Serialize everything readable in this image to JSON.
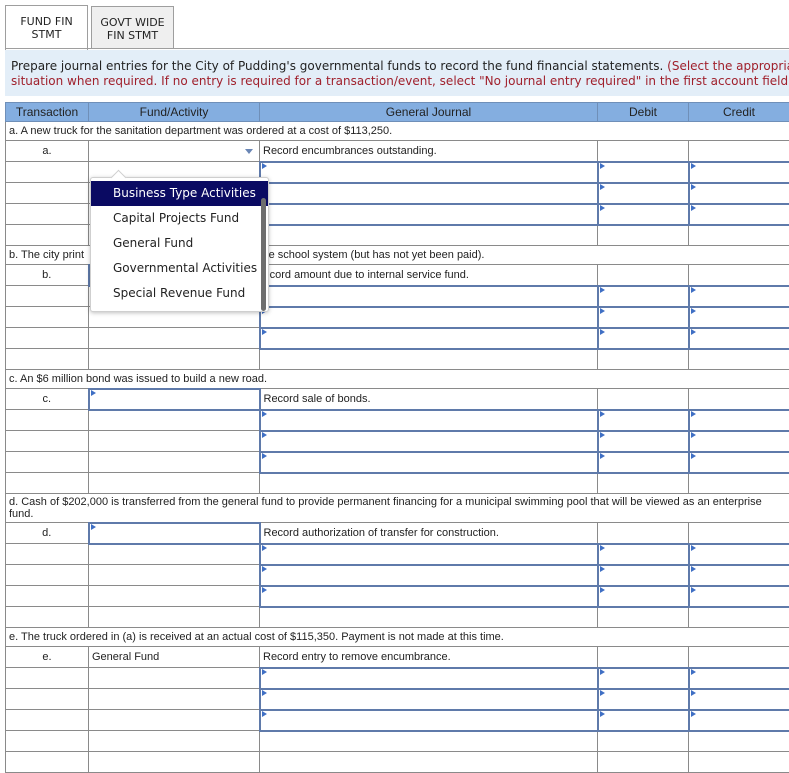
{
  "tabs": [
    {
      "line1": "FUND FIN",
      "line2": "STMT",
      "active": true
    },
    {
      "line1": "GOVT WIDE",
      "line2": "FIN STMT",
      "active": false
    }
  ],
  "instructions": {
    "line1_black": "Prepare journal entries for the City of Pudding's governmental funds to record the fund financial statements.",
    "line1_red": " (Select the appropriate",
    "line2_red": "situation when required. If no entry is required for a transaction/event, select \"No journal entry required\" in the first account field.)"
  },
  "table": {
    "headers": [
      "Transaction",
      "Fund/Activity",
      "General Journal",
      "Debit",
      "Credit"
    ],
    "transactions": [
      {
        "description": "a. A new truck for the sanitation department was ordered at a cost of $113,250.",
        "label": "a.",
        "fund_value": "",
        "journal_note": "Record encumbrances outstanding."
      },
      {
        "description": "b. The city print",
        "description_right": "he school system (but has not yet been paid).",
        "label": "b.",
        "fund_value": "",
        "journal_note": "ecord amount due to internal service fund."
      },
      {
        "description": "c. An $6 million bond was issued to build a new road.",
        "label": "c.",
        "fund_value": "",
        "journal_note": "Record sale of bonds."
      },
      {
        "description": "d. Cash of $202,000 is transferred from the general fund to provide permanent financing for a municipal swimming pool that will be viewed as an enterprise fund.",
        "label": "d.",
        "fund_value": "",
        "journal_note": "Record authorization of transfer for construction."
      },
      {
        "description": "e. The truck ordered in (a) is received at an actual cost of $115,350. Payment is not made at this time.",
        "label": "e.",
        "fund_value": "General Fund",
        "journal_note": "Record entry to remove encumbrance."
      }
    ]
  },
  "dropdown": {
    "options": [
      "Business Type Activities",
      "Capital Projects Fund",
      "General Fund",
      "Governmental Activities",
      "Special Revenue Fund"
    ],
    "highlighted": "Business Type Activities"
  }
}
